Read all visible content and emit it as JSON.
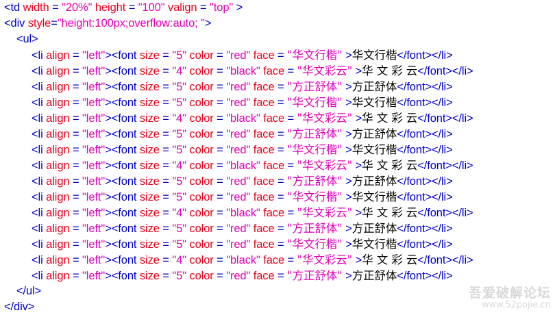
{
  "code": {
    "td_open": {
      "tag": "<td",
      "attrs": [
        {
          "name": "width",
          "value": "\"20%\""
        },
        {
          "name": "height",
          "value": "\"100\""
        },
        {
          "name": "valign",
          "value": "\"top\""
        }
      ],
      "close": " >"
    },
    "div_open": {
      "tag": "<div",
      "attr": "style",
      "value": "\"height:100px;overflow:auto; \"",
      "close": ">"
    },
    "ul_open": "<ul>",
    "ul_close": "</ul>",
    "div_close": "</div>",
    "li_open": "<li",
    "li_attr": "align",
    "li_val": "\"left\"",
    "font_open": "><font",
    "size_attr": "size",
    "color_attr": "color",
    "face_attr": "face",
    "eq": " = ",
    "font_close_tail": "</font></li>",
    "items": [
      {
        "size": "\"5\"",
        "color": "\"red\"",
        "face": "\"华文行楷\"",
        "text": "华文行楷"
      },
      {
        "size": "\"4\"",
        "color": "\"black\"",
        "face": "\"华文彩云\"",
        "text": "华 文 彩 云"
      },
      {
        "size": "\"5\"",
        "color": "\"red\"",
        "face": "\"方正舒体\"",
        "text": "方正舒体"
      },
      {
        "size": "\"5\"",
        "color": "\"red\"",
        "face": "\"华文行楷\"",
        "text": "华文行楷"
      },
      {
        "size": "\"4\"",
        "color": "\"black\"",
        "face": "\"华文彩云\"",
        "text": "华 文 彩 云"
      },
      {
        "size": "\"5\"",
        "color": "\"red\"",
        "face": "\"方正舒体\"",
        "text": "方正舒体"
      },
      {
        "size": "\"5\"",
        "color": "\"red\"",
        "face": "\"华文行楷\"",
        "text": "华文行楷"
      },
      {
        "size": "\"4\"",
        "color": "\"black\"",
        "face": "\"华文彩云\"",
        "text": "华 文 彩 云"
      },
      {
        "size": "\"5\"",
        "color": "\"red\"",
        "face": "\"方正舒体\"",
        "text": "方正舒体"
      },
      {
        "size": "\"5\"",
        "color": "\"red\"",
        "face": "\"华文行楷\"",
        "text": "华文行楷"
      },
      {
        "size": "\"4\"",
        "color": "\"black\"",
        "face": "\"华文彩云\"",
        "text": "华 文 彩 云"
      },
      {
        "size": "\"5\"",
        "color": "\"red\"",
        "face": "\"方正舒体\"",
        "text": "方正舒体"
      },
      {
        "size": "\"5\"",
        "color": "\"red\"",
        "face": "\"华文行楷\"",
        "text": "华文行楷"
      },
      {
        "size": "\"4\"",
        "color": "\"black\"",
        "face": "\"华文彩云\"",
        "text": "华 文 彩 云"
      },
      {
        "size": "\"5\"",
        "color": "\"red\"",
        "face": "\"方正舒体\"",
        "text": "方正舒体"
      }
    ]
  },
  "watermark": {
    "title": "吾爱破解论坛",
    "url": "www.52pojie.cn"
  },
  "colors": {
    "tag": "#0000cc",
    "attribute": "#e8001c",
    "value": "#e000b8",
    "text": "#000000"
  }
}
